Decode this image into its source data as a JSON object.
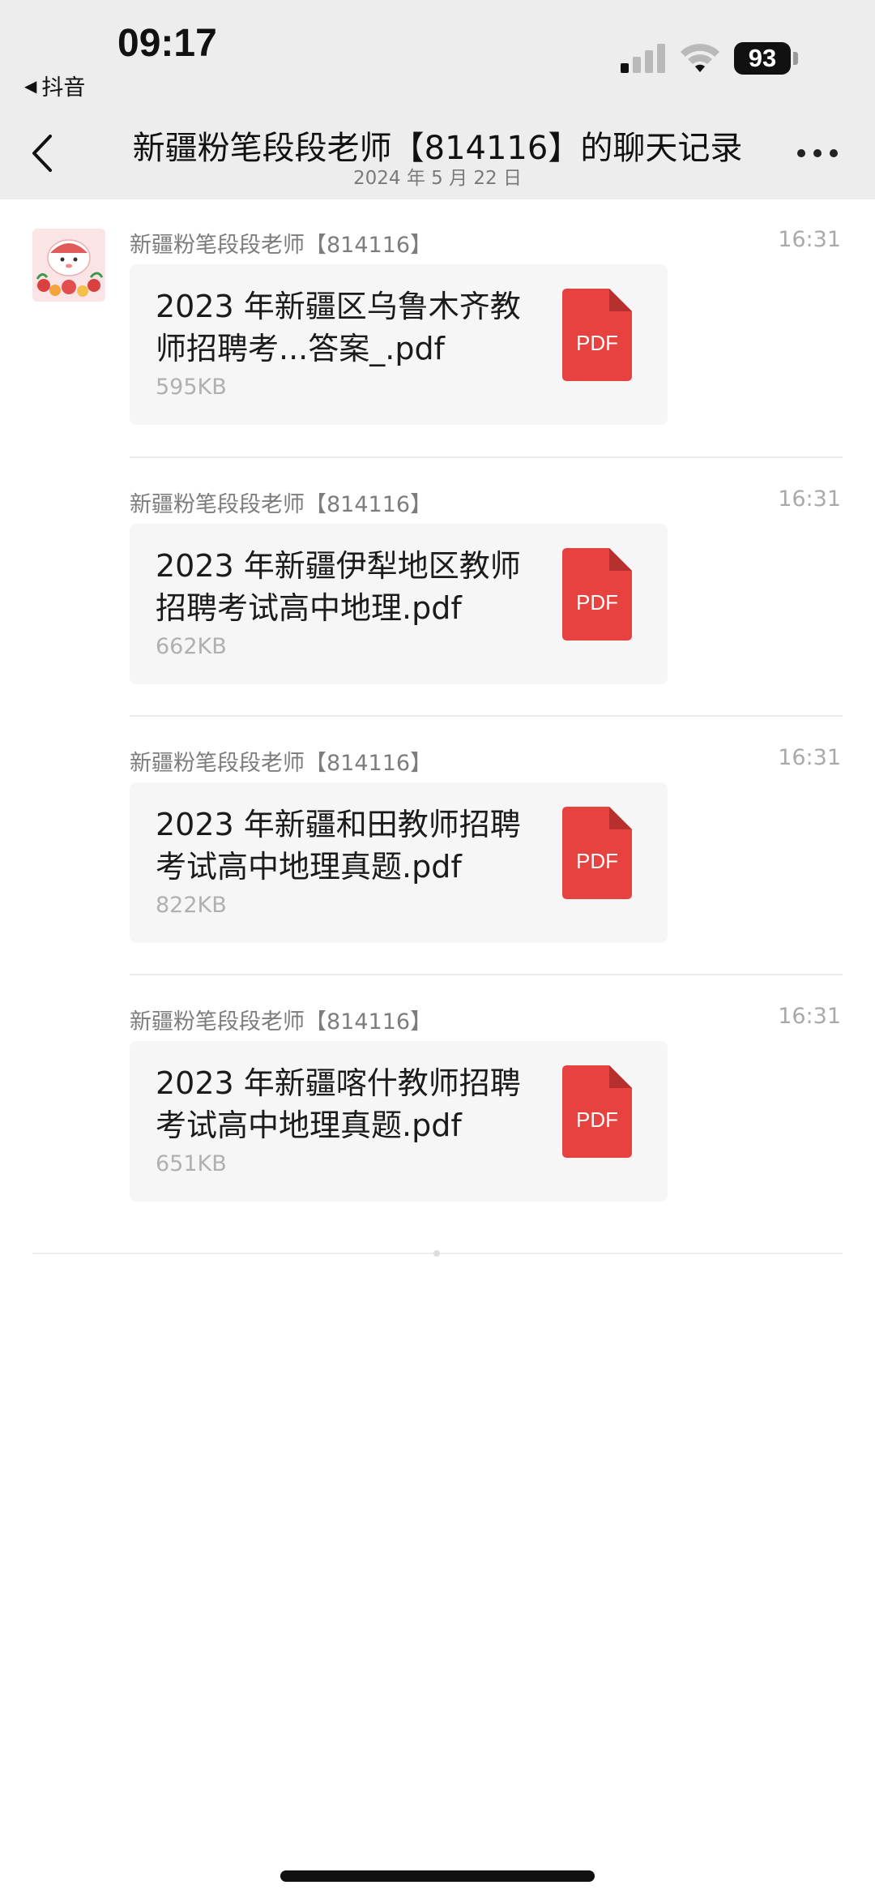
{
  "status_bar": {
    "time": "09:17",
    "back_app": "抖音",
    "battery": "93"
  },
  "nav": {
    "title": "新疆粉笔段段老师【814116】的聊天记录",
    "date": "2024 年 5 月 22 日"
  },
  "messages": [
    {
      "sender": "新疆粉笔段段老师【814116】",
      "time": "16:31",
      "file_name": "2023 年新疆区乌鲁木齐教师招聘考...答案_.pdf",
      "file_size": "595KB",
      "file_type": "PDF"
    },
    {
      "sender": "新疆粉笔段段老师【814116】",
      "time": "16:31",
      "file_name": "2023 年新疆伊犁地区教师招聘考试高中地理.pdf",
      "file_size": "662KB",
      "file_type": "PDF"
    },
    {
      "sender": "新疆粉笔段段老师【814116】",
      "time": "16:31",
      "file_name": "2023 年新疆和田教师招聘考试高中地理真题.pdf",
      "file_size": "822KB",
      "file_type": "PDF"
    },
    {
      "sender": "新疆粉笔段段老师【814116】",
      "time": "16:31",
      "file_name": "2023 年新疆喀什教师招聘考试高中地理真题.pdf",
      "file_size": "651KB",
      "file_type": "PDF"
    }
  ],
  "colors": {
    "header_bg": "#ededed",
    "pdf_red": "#e64340",
    "card_bg": "#f6f6f6"
  },
  "icons": [
    "back-arrow-icon",
    "signal-icon",
    "wifi-icon",
    "battery-icon",
    "chevron-left-icon",
    "more-icon",
    "pdf-icon"
  ]
}
